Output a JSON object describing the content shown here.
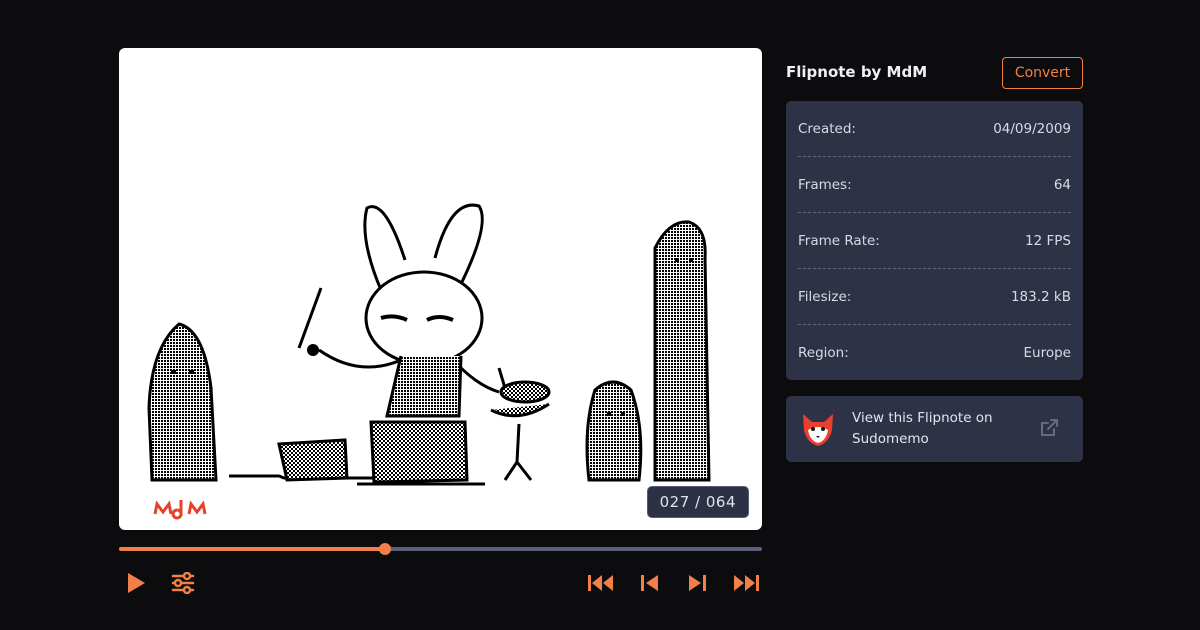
{
  "player": {
    "frame_counter": "027 / 064",
    "current_frame": 27,
    "total_frames": 64,
    "progress_fraction": 0.414,
    "signature_text": "MdM"
  },
  "controls": {
    "play": "play-icon",
    "settings": "sliders-icon",
    "first": "skip-to-first-icon",
    "prev": "previous-frame-icon",
    "next": "next-frame-icon",
    "last": "skip-to-last-icon"
  },
  "sidebar": {
    "title": "Flipnote by MdM",
    "convert_label": "Convert",
    "meta": [
      {
        "label": "Created:",
        "value": "04/09/2009"
      },
      {
        "label": "Frames:",
        "value": "64"
      },
      {
        "label": "Frame Rate:",
        "value": "12 FPS"
      },
      {
        "label": "Filesize:",
        "value": "183.2 kB"
      },
      {
        "label": "Region:",
        "value": "Europe"
      }
    ],
    "sudomemo": {
      "line1": "View this Flipnote on",
      "line2": "Sudomemo"
    }
  },
  "colors": {
    "accent": "#f08048",
    "panel": "#2e3247",
    "background": "#0c0b0e",
    "signature_red": "#e8402c"
  }
}
